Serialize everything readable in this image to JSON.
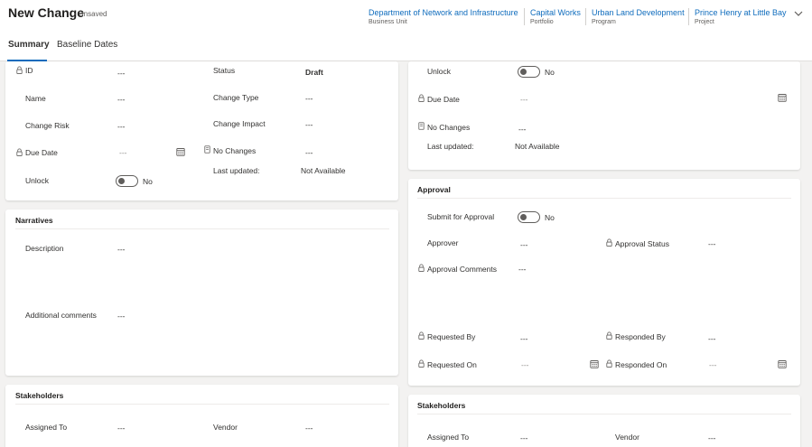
{
  "header": {
    "title": "New Change",
    "status": "- Unsaved",
    "breadcrumbs": [
      {
        "name": "Department of Network and Infrastructure",
        "type": "Business Unit"
      },
      {
        "name": "Capital Works",
        "type": "Portfolio"
      },
      {
        "name": "Urban Land Development",
        "type": "Program"
      },
      {
        "name": "Prince Henry at Little Bay",
        "type": "Project"
      }
    ]
  },
  "tabs": [
    {
      "label": "Summary",
      "active": true
    },
    {
      "label": "Baseline Dates",
      "active": false
    }
  ],
  "general": {
    "id_label": "ID",
    "id_value": "---",
    "status_label": "Status",
    "status_value": "Draft",
    "name_label": "Name",
    "name_value": "---",
    "change_type_label": "Change Type",
    "change_type_value": "---",
    "change_risk_label": "Change Risk",
    "change_risk_value": "---",
    "change_impact_label": "Change Impact",
    "change_impact_value": "---",
    "due_date_label": "Due Date",
    "due_date_value": "---",
    "no_changes_label": "No Changes",
    "no_changes_value": "---",
    "last_updated_label": "Last updated:",
    "last_updated_value": "Not Available",
    "unlock_label": "Unlock",
    "unlock_value": "No"
  },
  "narratives": {
    "title": "Narratives",
    "description_label": "Description",
    "description_value": "---",
    "comments_label": "Additional comments",
    "comments_value": "---"
  },
  "stakeholders_left": {
    "title": "Stakeholders",
    "assigned_label": "Assigned To",
    "assigned_value": "---",
    "vendor_label": "Vendor",
    "vendor_value": "---"
  },
  "right_top": {
    "unlock_label": "Unlock",
    "unlock_value": "No",
    "due_date_label": "Due Date",
    "due_date_value": "---",
    "no_changes_label": "No Changes",
    "no_changes_value": "---",
    "last_updated_label": "Last updated:",
    "last_updated_value": "Not Available"
  },
  "approval": {
    "title": "Approval",
    "submit_label": "Submit for Approval",
    "submit_value": "No",
    "approver_label": "Approver",
    "approver_value": "---",
    "approval_status_label": "Approval Status",
    "approval_status_value": "---",
    "comments_label": "Approval Comments",
    "comments_value": "---",
    "requested_by_label": "Requested By",
    "requested_by_value": "---",
    "responded_by_label": "Responded By",
    "responded_by_value": "---",
    "requested_on_label": "Requested On",
    "requested_on_value": "---",
    "responded_on_label": "Responded On",
    "responded_on_value": "---"
  },
  "stakeholders_right": {
    "title": "Stakeholders",
    "assigned_label": "Assigned To",
    "assigned_value": "---",
    "vendor_label": "Vendor",
    "vendor_value": "---"
  },
  "colors": {
    "accent": "#0f6cbd",
    "background": "#f3f2f1"
  },
  "icons": [
    "lock-icon",
    "calendar-icon",
    "document-icon",
    "chevron-down-icon"
  ]
}
